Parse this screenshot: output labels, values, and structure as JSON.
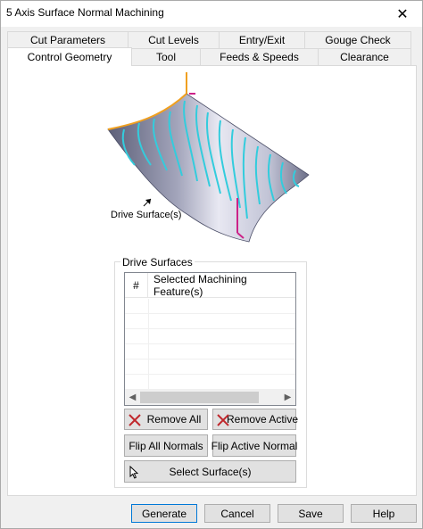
{
  "window": {
    "title": "5 Axis Surface Normal Machining",
    "close_glyph": "✕"
  },
  "tabs": {
    "row1": [
      "Cut Parameters",
      "Cut Levels",
      "Entry/Exit",
      "Gouge Check"
    ],
    "row2": [
      "Control Geometry",
      "Tool",
      "Feeds & Speeds",
      "Clearance"
    ],
    "active": "Control Geometry"
  },
  "illustration": {
    "label": "Drive Surface(s)",
    "colors": {
      "toolpath": "#33ccdd",
      "edge": "#f0a020",
      "tool_axis": "#cc2288",
      "surface_dark": "#5c5f78",
      "surface_light": "#e8e8f2"
    }
  },
  "drive_surfaces": {
    "group_label": "Drive Surfaces",
    "columns": [
      "#",
      "Selected Machining Feature(s)"
    ],
    "rows": []
  },
  "buttons": {
    "remove_all": "Remove All",
    "remove_active": "Remove Active",
    "flip_all_normals": "Flip All Normals",
    "flip_active_normal": "Flip Active Normal",
    "select_surfaces": "Select Surface(s)"
  },
  "footer": {
    "generate": "Generate",
    "cancel": "Cancel",
    "save": "Save",
    "help": "Help"
  },
  "icons": {
    "remove": "red-x-icon",
    "select": "cursor-arrow-icon",
    "scroll_left": "◀",
    "scroll_right": "▶"
  }
}
